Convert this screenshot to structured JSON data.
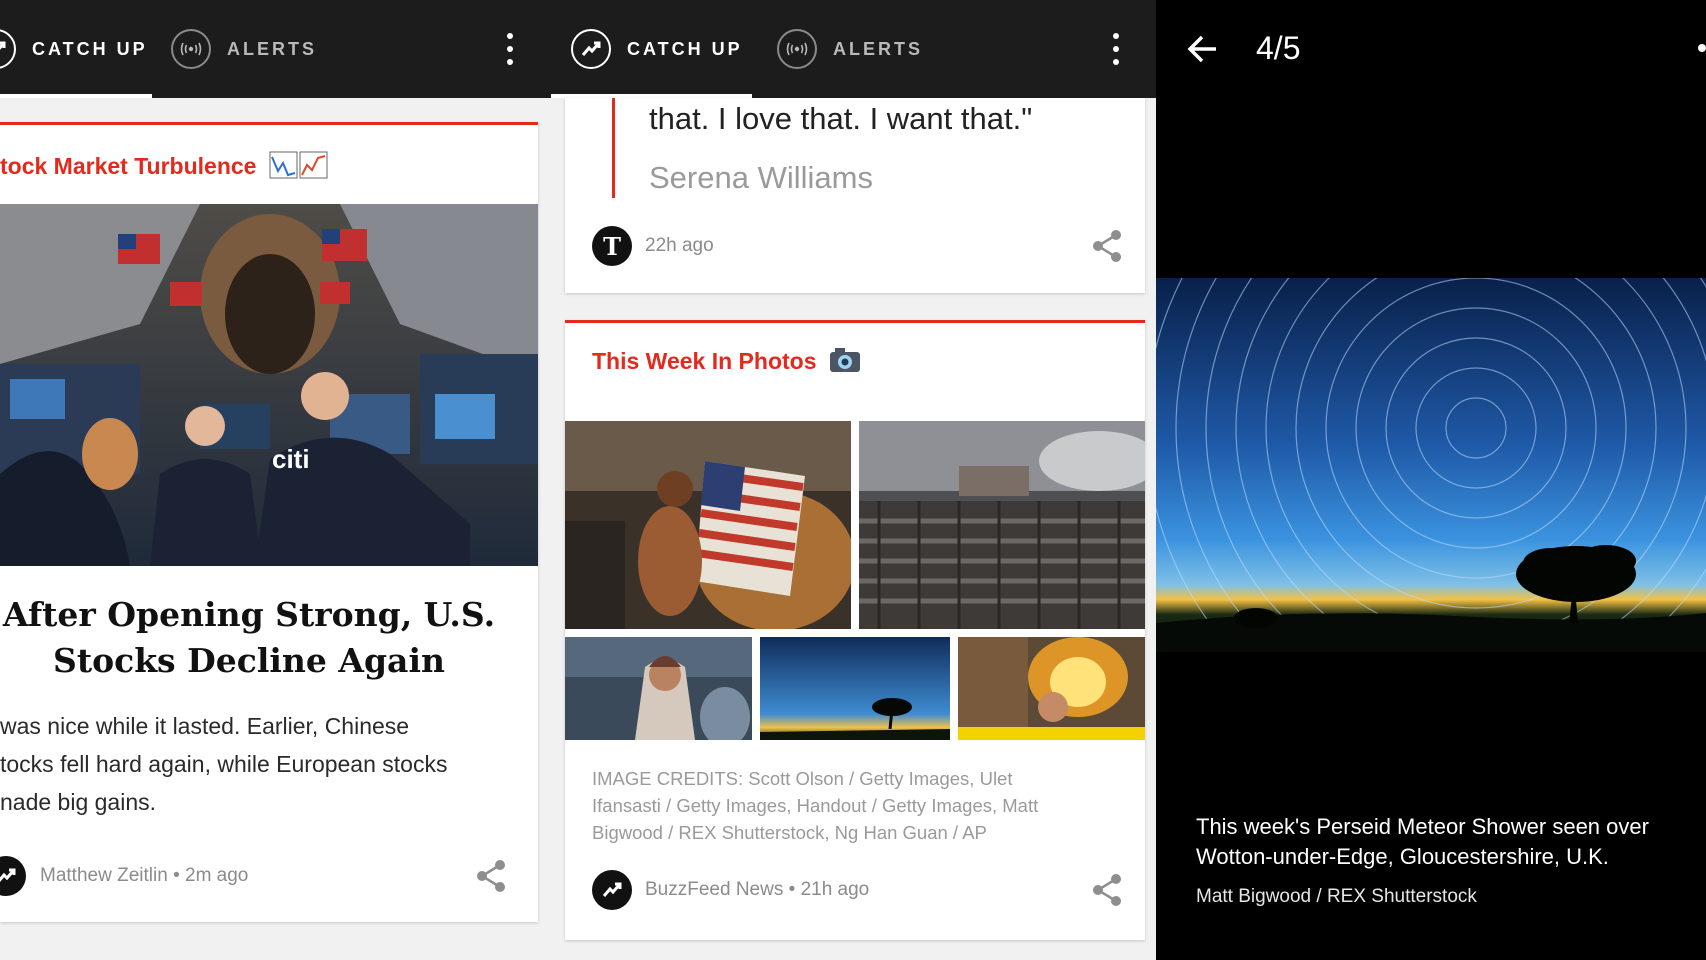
{
  "app": {
    "tabs": {
      "catch_up": "CATCH UP",
      "alerts": "ALERTS"
    },
    "accent": "#e32a1c"
  },
  "panel1": {
    "card": {
      "header": "tock Market Turbulence",
      "header_icon": "stock-chart-emoji",
      "headline": "After Opening Strong, U.S. Stocks Decline Again",
      "body_lines": [
        "was nice while it lasted. Earlier, Chinese",
        "tocks fell hard again, while European stocks",
        "nade big gains."
      ],
      "author": "Matthew Zeitlin",
      "time": "2m ago",
      "separator": "•"
    }
  },
  "panel2": {
    "quote_card": {
      "quote_line": "that. I love that. I want that.\"",
      "quote_author": "Serena Williams",
      "source_logo_glyph": "T",
      "time": "22h ago"
    },
    "photos_card": {
      "header": "This Week In Photos",
      "header_icon": "camera-emoji",
      "credits": "IMAGE CREDITS: Scott Olson / Getty Images, Ulet Ifansasti / Getty Images, Handout / Getty Images, Matt Bigwood / REX Shutterstock, Ng Han Guan / AP",
      "credit_lines": [
        "IMAGE CREDITS: Scott Olson / Getty Images, Ulet",
        "Ifansasti / Getty Images, Handout / Getty Images, Matt",
        "Bigwood / REX Shutterstock, Ng Han Guan / AP"
      ],
      "source": "BuzzFeed News",
      "time": "21h ago",
      "separator": "•"
    }
  },
  "panel3": {
    "counter": "4/5",
    "caption_lines": [
      "This week's Perseid Meteor Shower seen over",
      "Wotton-under-Edge, Gloucestershire, U.K."
    ],
    "credit": "Matt Bigwood / REX Shutterstock"
  }
}
